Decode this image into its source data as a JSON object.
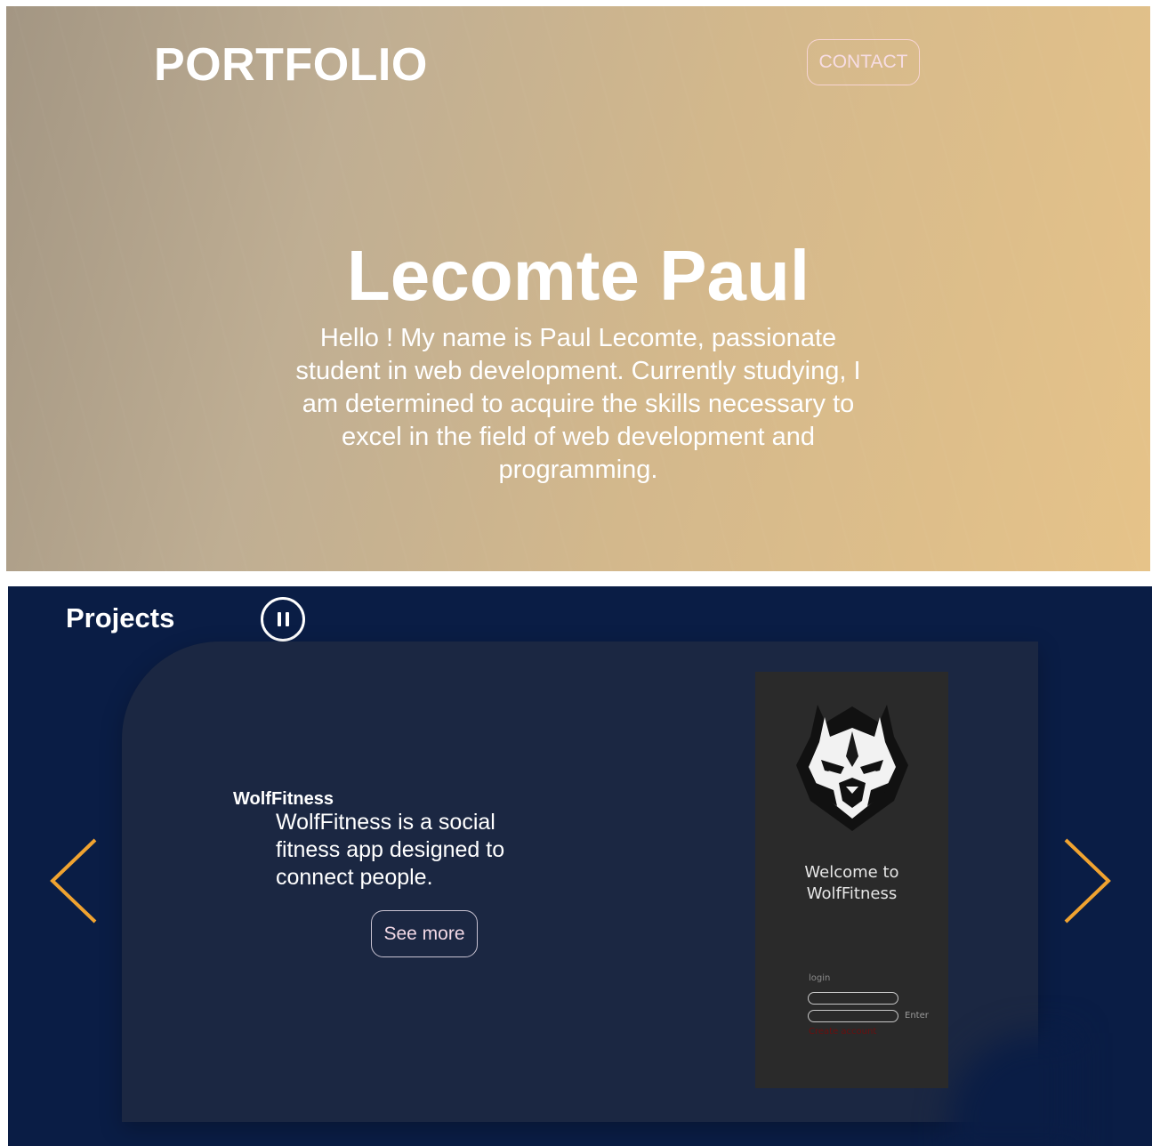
{
  "hero": {
    "brand": "PORTFOLIO",
    "contact_label": "CONTACT",
    "name": "Lecomte Paul",
    "intro": "Hello ! My name is Paul Lecomte, passionate student in web development. Currently studying, I am determined to acquire the skills necessary to excel in the field of web development and programming."
  },
  "projects": {
    "title": "Projects",
    "pause_icon": "pause-icon",
    "arrow_left_icon": "chevron-left-icon",
    "arrow_right_icon": "chevron-right-icon",
    "current": {
      "name": "WolfFitness",
      "description": "WolfFitness is a social fitness app designed to connect people.",
      "see_more_label": "See more",
      "preview": {
        "welcome_line1": "Welcome to",
        "welcome_line2": "WolfFitness",
        "login_label": "login",
        "enter_label": "Enter",
        "create_account_label": "Create account"
      }
    }
  },
  "colors": {
    "hero_gradient_start": "#a39683",
    "hero_gradient_end": "#e6c389",
    "projects_bg": "#0a1d45",
    "card_bg": "#1b2742",
    "arrow": "#f0a330",
    "phone_bg": "#2a2a2a"
  }
}
